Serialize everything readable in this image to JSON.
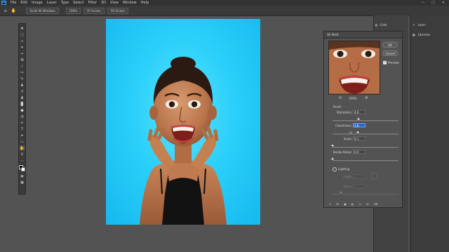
{
  "menubar": {
    "logo": "Ps",
    "items": [
      "File",
      "Edit",
      "Image",
      "Layer",
      "Type",
      "Select",
      "Filter",
      "3D",
      "View",
      "Window",
      "Help"
    ]
  },
  "options_bar": {
    "scroll_all": "Scroll All Windows",
    "zoom": "100%",
    "fit_screen": "Fit Screen",
    "fill_screen": "Fill Screen"
  },
  "right_panels": {
    "color": "Color",
    "learn": "Learn",
    "libraries": "Libraries"
  },
  "oil_paint": {
    "title": "Oil Paint",
    "ok": "OK",
    "cancel": "Cancel",
    "preview_label": "Preview",
    "preview_checked": true,
    "zoom": "100%",
    "brush_section": "Brush",
    "stylization_label": "Stylization:",
    "stylization_value": "4.8",
    "stylization_level": 0.39,
    "cleanliness_label": "Cleanliness:",
    "cleanliness_value": "3.8",
    "cleanliness_level": 0.38,
    "scale_label": "Scale:",
    "scale_value": "0.1",
    "scale_level": 0.0,
    "bristle_label": "Bristle Detail:",
    "bristle_value": "0.0",
    "bristle_level": 0.0,
    "lighting_label": "Lighting",
    "lighting_checked": false,
    "angle_label": "Angle:",
    "shine_label": "Shine:"
  },
  "colors": {
    "app_bg": "#535353",
    "canvas_blue": "#2bd0fa",
    "selection_blue": "#2a66c8"
  }
}
